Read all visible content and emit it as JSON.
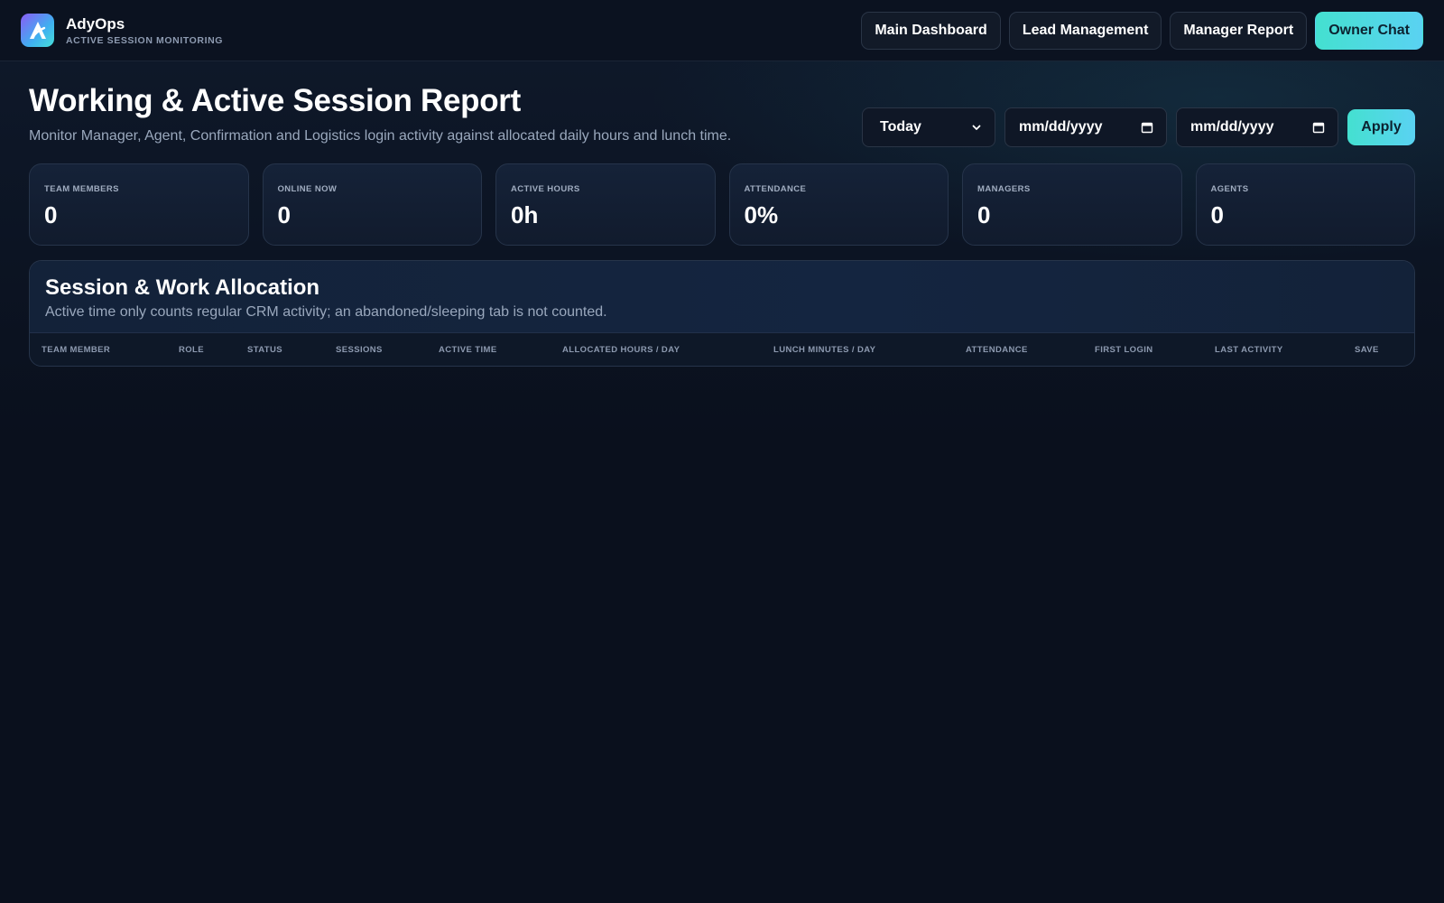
{
  "brand": {
    "name": "AdyOps",
    "subtitle": "ACTIVE SESSION MONITORING",
    "logo_icon": "logo-a-icon"
  },
  "nav": {
    "main_dashboard": "Main Dashboard",
    "lead_management": "Lead Management",
    "manager_report": "Manager Report",
    "owner_chat": "Owner Chat"
  },
  "header": {
    "title": "Working & Active Session Report",
    "description": "Monitor Manager, Agent, Confirmation and Logistics login activity against allocated daily hours and lunch time."
  },
  "filters": {
    "range": "Today",
    "start_date_placeholder": "mm/dd/yyyy",
    "end_date_placeholder": "mm/dd/yyyy",
    "apply": "Apply"
  },
  "stats": [
    {
      "label": "TEAM MEMBERS",
      "value": "0"
    },
    {
      "label": "ONLINE NOW",
      "value": "0"
    },
    {
      "label": "ACTIVE HOURS",
      "value": "0h"
    },
    {
      "label": "ATTENDANCE",
      "value": "0%"
    },
    {
      "label": "MANAGERS",
      "value": "0"
    },
    {
      "label": "AGENTS",
      "value": "0"
    }
  ],
  "panel": {
    "title": "Session & Work Allocation",
    "description": "Active time only counts regular CRM activity; an abandoned/sleeping tab is not counted.",
    "columns": [
      "TEAM MEMBER",
      "ROLE",
      "STATUS",
      "SESSIONS",
      "ACTIVE TIME",
      "ALLOCATED HOURS / DAY",
      "LUNCH MINUTES / DAY",
      "ATTENDANCE",
      "FIRST LOGIN",
      "LAST ACTIVITY",
      "SAVE"
    ]
  },
  "colors": {
    "accent": "#44e0d0",
    "accent_end": "#5ad2f2",
    "background": "#0a101d"
  }
}
